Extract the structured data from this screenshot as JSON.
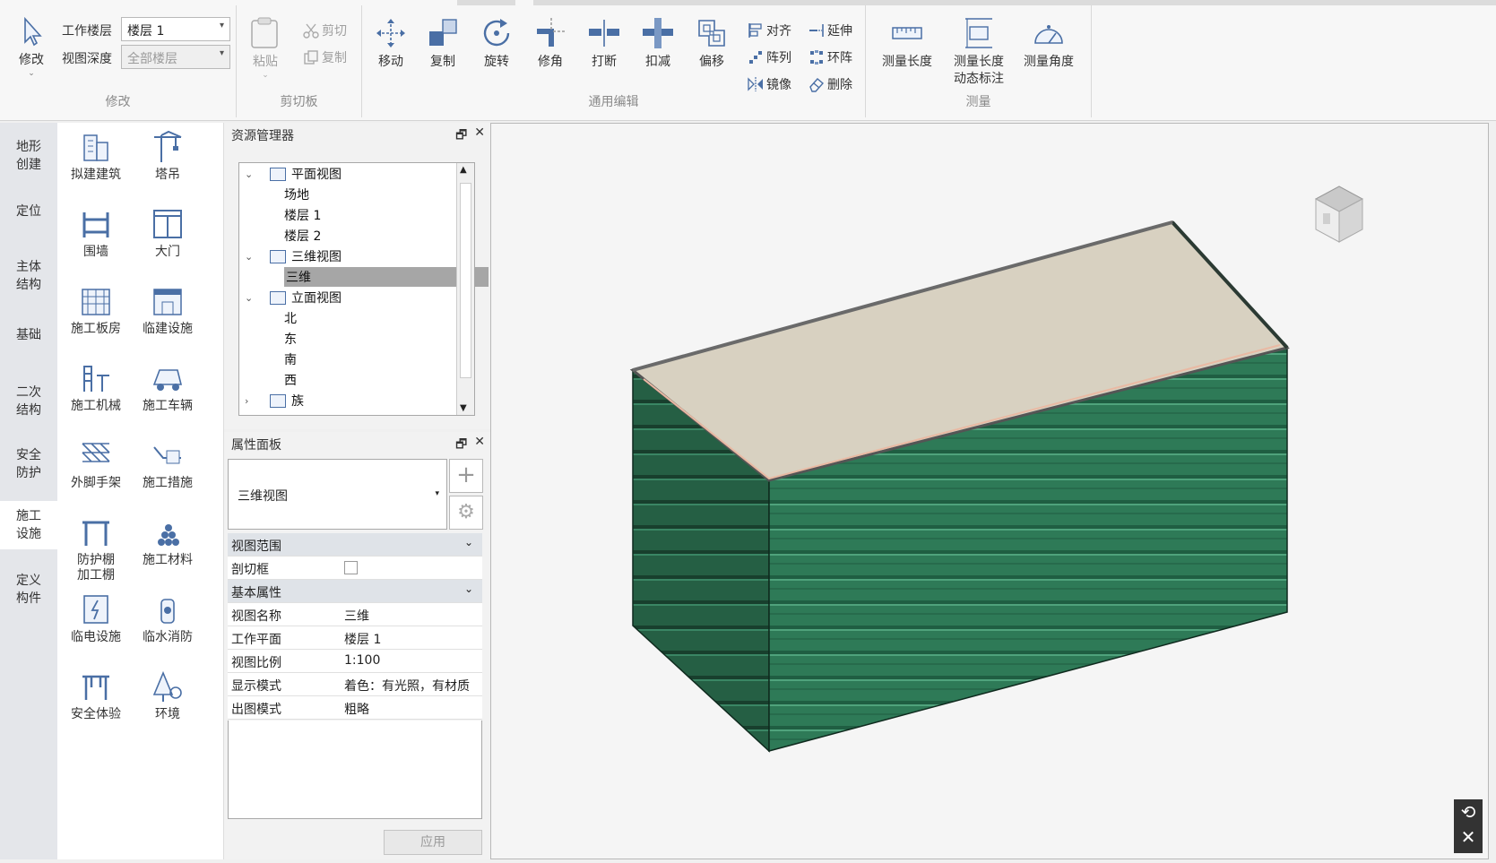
{
  "ribbon": {
    "modify": {
      "label": "修改",
      "button": "修改",
      "work_floor_label": "工作楼层",
      "work_floor_value": "楼层 1",
      "view_depth_label": "视图深度",
      "view_depth_value": "全部楼层"
    },
    "clipboard": {
      "label": "剪切板",
      "paste": "粘贴",
      "cut": "剪切",
      "copy": "复制"
    },
    "edit": {
      "label": "通用编辑",
      "move": "移动",
      "copy": "复制",
      "rotate": "旋转",
      "trim": "修角",
      "break": "打断",
      "deduct": "扣减",
      "offset": "偏移",
      "align": "对齐",
      "extend": "延伸",
      "array": "阵列",
      "ring": "环阵",
      "mirror": "镜像",
      "delete": "删除"
    },
    "measure": {
      "label": "测量",
      "length": "测量长度",
      "dynamic_line1": "测量长度",
      "dynamic_line2": "动态标注",
      "angle": "测量角度"
    }
  },
  "vtabs": [
    {
      "line1": "地形",
      "line2": "创建"
    },
    {
      "line1": "定位",
      "line2": ""
    },
    {
      "line1": "主体",
      "line2": "结构"
    },
    {
      "line1": "基础",
      "line2": ""
    },
    {
      "line1": "二次",
      "line2": "结构"
    },
    {
      "line1": "安全",
      "line2": "防护"
    },
    {
      "line1": "施工",
      "line2": "设施"
    },
    {
      "line1": "定义",
      "line2": "构件"
    }
  ],
  "palette": [
    {
      "line1": "拟建建筑",
      "line2": "",
      "icon": "building-icon"
    },
    {
      "line1": "塔吊",
      "line2": "",
      "icon": "tower-crane-icon"
    },
    {
      "line1": "围墙",
      "line2": "",
      "icon": "fence-icon"
    },
    {
      "line1": "大门",
      "line2": "",
      "icon": "gate-icon"
    },
    {
      "line1": "施工板房",
      "line2": "",
      "icon": "site-office-icon"
    },
    {
      "line1": "临建设施",
      "line2": "",
      "icon": "temp-facility-icon"
    },
    {
      "line1": "施工机械",
      "line2": "",
      "icon": "machinery-icon"
    },
    {
      "line1": "施工车辆",
      "line2": "",
      "icon": "vehicle-icon"
    },
    {
      "line1": "外脚手架",
      "line2": "",
      "icon": "scaffold-icon"
    },
    {
      "line1": "施工措施",
      "line2": "",
      "icon": "measure-icon"
    },
    {
      "line1": "防护棚",
      "line2": "加工棚",
      "icon": "shed-icon"
    },
    {
      "line1": "施工材料",
      "line2": "",
      "icon": "materials-icon"
    },
    {
      "line1": "临电设施",
      "line2": "",
      "icon": "electric-icon"
    },
    {
      "line1": "临水消防",
      "line2": "",
      "icon": "hydrant-icon"
    },
    {
      "line1": "安全体验",
      "line2": "",
      "icon": "safety-icon"
    },
    {
      "line1": "环境",
      "line2": "",
      "icon": "tree-icon"
    }
  ],
  "resource": {
    "title": "资源管理器",
    "tree": [
      {
        "label": "平面视图",
        "level": 0,
        "expand": "v"
      },
      {
        "label": "场地",
        "level": 1
      },
      {
        "label": "楼层 1",
        "level": 1
      },
      {
        "label": "楼层 2",
        "level": 1
      },
      {
        "label": "三维视图",
        "level": 0,
        "expand": "v"
      },
      {
        "label": "三维",
        "level": 1,
        "selected": true
      },
      {
        "label": "立面视图",
        "level": 0,
        "expand": "v"
      },
      {
        "label": "北",
        "level": 1
      },
      {
        "label": "东",
        "level": 1
      },
      {
        "label": "南",
        "level": 1
      },
      {
        "label": "西",
        "level": 1
      },
      {
        "label": "族",
        "level": 0,
        "expand": ">"
      }
    ]
  },
  "props": {
    "title": "属性面板",
    "type_value": "三维视图",
    "section1": "视图范围",
    "crop_label": "剖切框",
    "section2": "基本属性",
    "rows": [
      {
        "k": "视图名称",
        "v": "三维"
      },
      {
        "k": "工作平面",
        "v": "楼层 1"
      },
      {
        "k": "视图比例",
        "v": "1:100"
      },
      {
        "k": "显示模式",
        "v": "着色：有光照，有材质"
      },
      {
        "k": "出图模式",
        "v": "粗略"
      }
    ],
    "apply": "应用"
  },
  "colors": {
    "wall": "#2d7d5a",
    "roof": "#d8d1c1"
  }
}
